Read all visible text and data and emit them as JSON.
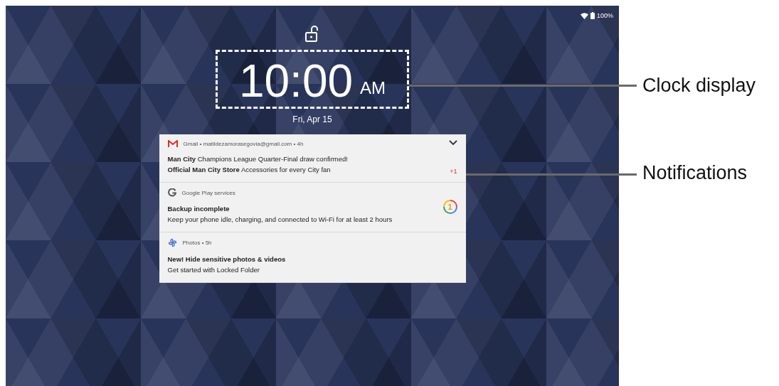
{
  "status_bar": {
    "battery": "100%"
  },
  "clock": {
    "time": "10:00",
    "meridiem": "AM",
    "date": "Fri, Apr 15"
  },
  "notifications": [
    {
      "kind": "gmail",
      "header": "Gmail • matildezamorasegovia@gmail.com • 4h",
      "lines": [
        "**Man City** Champions League Quarter-Final draw confirmed!",
        "**Official Man City Store** Accessories for every City fan"
      ],
      "more": "+1"
    },
    {
      "kind": "google",
      "header": "Google Play services",
      "title": "Backup incomplete",
      "text": "Keep your phone idle, charging, and connected to Wi-Fi for at least 2 hours",
      "badge": "1"
    },
    {
      "kind": "photos",
      "header": "Photos • 5h",
      "title": "New! Hide sensitive photos & videos",
      "text": "Get started with Locked Folder"
    }
  ],
  "callouts": [
    {
      "label": "Clock display"
    },
    {
      "label": "Notifications"
    }
  ]
}
